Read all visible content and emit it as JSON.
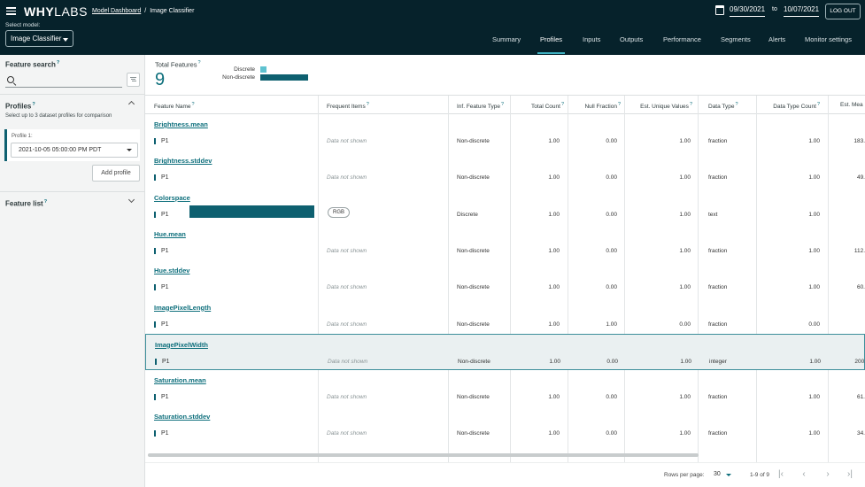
{
  "header": {
    "logo_bold": "WHY",
    "logo_light": "LABS",
    "breadcrumb": [
      "Model Dashboard",
      "Image Classifier"
    ],
    "select_model_label": "Select model:",
    "selected_model": "Image Classifier",
    "date_from": "09/30/2021",
    "date_to_label": "to",
    "date_to": "10/07/2021",
    "logout_label": "LOG OUT",
    "tabs": [
      "Summary",
      "Profiles",
      "Inputs",
      "Outputs",
      "Performance",
      "Segments",
      "Alerts",
      "Monitor settings"
    ],
    "active_tab": "Profiles"
  },
  "sidebar": {
    "feature_search_title": "Feature search",
    "help_mark": "?",
    "profiles_title": "Profiles",
    "profiles_subtitle": "Select up to 3 dataset profiles for comparison",
    "profile_label": "Profile 1:",
    "profile_value": "2021-10-05 05:00:00 PM PDT",
    "add_profile_label": "Add profile",
    "feature_list_title": "Feature list"
  },
  "summary": {
    "total_features_label": "Total Features",
    "total_features_value": "9",
    "legend_discrete": "Discrete",
    "legend_nondiscrete": "Non-discrete",
    "discrete_count": 1,
    "nondiscrete_count": 8
  },
  "table": {
    "columns": [
      "Feature Name",
      "Frequent Items",
      "Inf. Feature Type",
      "Total Count",
      "Null Fraction",
      "Est. Unique Values",
      "Data Type",
      "Data Type Count",
      "Est. Mea"
    ],
    "rows": [
      {
        "name": "Brightness.mean",
        "profile": "P1",
        "frequent": "Data not shown",
        "inf_type": "Non-discrete",
        "total": "1.00",
        "null": "0.00",
        "unique": "1.00",
        "dtype": "fraction",
        "dtype_count": "1.00",
        "mean": "183."
      },
      {
        "name": "Brightness.stddev",
        "profile": "P1",
        "frequent": "Data not shown",
        "inf_type": "Non-discrete",
        "total": "1.00",
        "null": "0.00",
        "unique": "1.00",
        "dtype": "fraction",
        "dtype_count": "1.00",
        "mean": "49."
      },
      {
        "name": "Colorspace",
        "profile": "P1",
        "frequent": "RGB",
        "inf_type": "Discrete",
        "total": "1.00",
        "null": "0.00",
        "unique": "1.00",
        "dtype": "text",
        "dtype_count": "1.00",
        "mean": ""
      },
      {
        "name": "Hue.mean",
        "profile": "P1",
        "frequent": "Data not shown",
        "inf_type": "Non-discrete",
        "total": "1.00",
        "null": "0.00",
        "unique": "1.00",
        "dtype": "fraction",
        "dtype_count": "1.00",
        "mean": "112."
      },
      {
        "name": "Hue.stddev",
        "profile": "P1",
        "frequent": "Data not shown",
        "inf_type": "Non-discrete",
        "total": "1.00",
        "null": "0.00",
        "unique": "1.00",
        "dtype": "fraction",
        "dtype_count": "1.00",
        "mean": "60."
      },
      {
        "name": "ImagePixelLength",
        "profile": "P1",
        "frequent": "Data not shown",
        "inf_type": "Non-discrete",
        "total": "1.00",
        "null": "1.00",
        "unique": "0.00",
        "dtype": "fraction",
        "dtype_count": "0.00",
        "mean": ""
      },
      {
        "name": "ImagePixelWidth",
        "profile": "P1",
        "frequent": "Data not shown",
        "inf_type": "Non-discrete",
        "total": "1.00",
        "null": "0.00",
        "unique": "1.00",
        "dtype": "integer",
        "dtype_count": "1.00",
        "mean": "200."
      },
      {
        "name": "Saturation.mean",
        "profile": "P1",
        "frequent": "Data not shown",
        "inf_type": "Non-discrete",
        "total": "1.00",
        "null": "0.00",
        "unique": "1.00",
        "dtype": "fraction",
        "dtype_count": "1.00",
        "mean": "61."
      },
      {
        "name": "Saturation.stddev",
        "profile": "P1",
        "frequent": "Data not shown",
        "inf_type": "Non-discrete",
        "total": "1.00",
        "null": "0.00",
        "unique": "1.00",
        "dtype": "fraction",
        "dtype_count": "1.00",
        "mean": "34."
      }
    ],
    "highlighted_row": "ImagePixelWidth"
  },
  "footer": {
    "rows_per_page_label": "Rows per page:",
    "rows_per_page": "30",
    "page_info": "1-9 of 9"
  },
  "colors": {
    "topbar": "#06222b",
    "accent": "#0e6f7c",
    "bar_dark": "#0e6070",
    "bar_light": "#5ec2d0",
    "highlight_bg": "#eaf0f1"
  }
}
